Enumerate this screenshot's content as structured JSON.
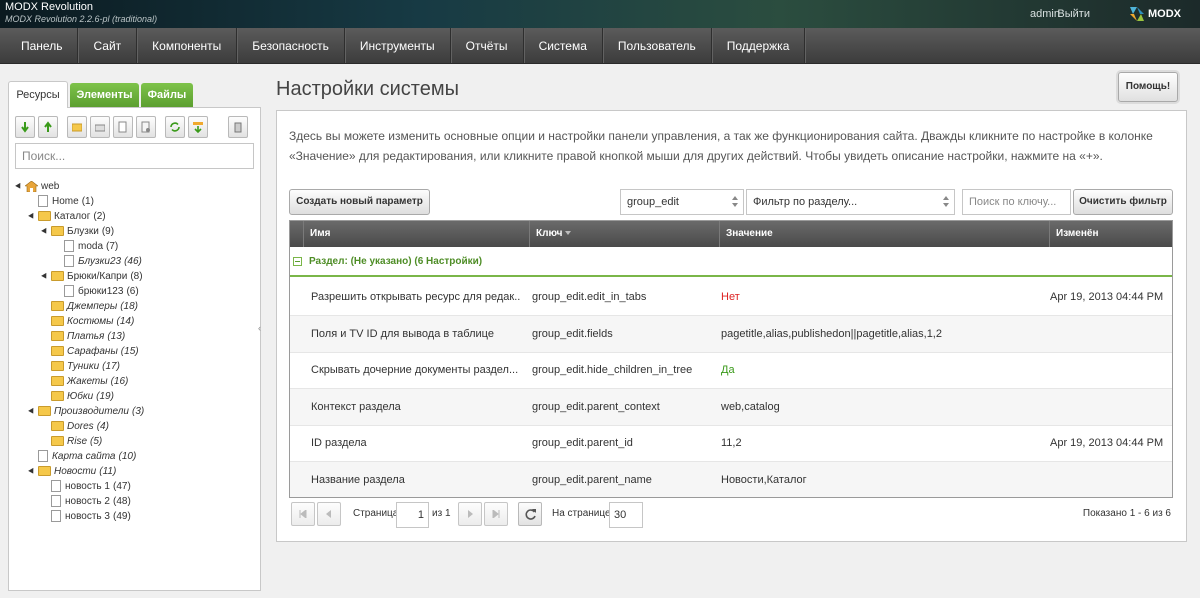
{
  "topbar": {
    "brand": "MODX Revolution",
    "version": "MODX Revolution 2.2.6-pl (traditional)",
    "user": "admin",
    "logout": "Выйти",
    "logo_text": "MODX"
  },
  "nav": [
    "Панель",
    "Сайт",
    "Компоненты",
    "Безопасность",
    "Инструменты",
    "Отчёты",
    "Система",
    "Пользователь",
    "Поддержка"
  ],
  "left": {
    "tabs": [
      "Ресурсы",
      "Элементы",
      "Файлы"
    ],
    "toolbar_icons": [
      "arrow-down-icon",
      "arrow-up-icon",
      "new-folder-icon",
      "new-weblink-icon",
      "new-document-icon",
      "new-static-icon",
      "refresh-icon",
      "sort-icon",
      "trash-icon"
    ],
    "search_placeholder": "Поиск...",
    "tree": [
      {
        "label": "web",
        "count": "",
        "type": "home",
        "level": 0,
        "italic": false
      },
      {
        "label": "Home",
        "count": "(1)",
        "type": "doc",
        "level": 1,
        "italic": false
      },
      {
        "label": "Каталог",
        "count": "(2)",
        "type": "folder",
        "level": 1,
        "italic": false,
        "open": true
      },
      {
        "label": "Блузки",
        "count": "(9)",
        "type": "folder",
        "level": 2,
        "italic": false,
        "open": true
      },
      {
        "label": "moda",
        "count": "(7)",
        "type": "doc",
        "level": 3,
        "italic": false
      },
      {
        "label": "Блузки23",
        "count": "(46)",
        "type": "doc",
        "level": 3,
        "italic": true
      },
      {
        "label": "Брюки/Капри",
        "count": "(8)",
        "type": "folder",
        "level": 2,
        "italic": false,
        "open": true
      },
      {
        "label": "брюки123",
        "count": "(6)",
        "type": "doc",
        "level": 3,
        "italic": false
      },
      {
        "label": "Джемперы",
        "count": "(18)",
        "type": "folder",
        "level": 2,
        "italic": true
      },
      {
        "label": "Костюмы",
        "count": "(14)",
        "type": "folder",
        "level": 2,
        "italic": true
      },
      {
        "label": "Платья",
        "count": "(13)",
        "type": "folder",
        "level": 2,
        "italic": true
      },
      {
        "label": "Сарафаны",
        "count": "(15)",
        "type": "folder",
        "level": 2,
        "italic": true
      },
      {
        "label": "Туники",
        "count": "(17)",
        "type": "folder",
        "level": 2,
        "italic": true
      },
      {
        "label": "Жакеты",
        "count": "(16)",
        "type": "folder",
        "level": 2,
        "italic": true
      },
      {
        "label": "Юбки",
        "count": "(19)",
        "type": "folder",
        "level": 2,
        "italic": true
      },
      {
        "label": "Производители",
        "count": "(3)",
        "type": "folder",
        "level": 1,
        "italic": true,
        "open": true
      },
      {
        "label": "Dores",
        "count": "(4)",
        "type": "folder",
        "level": 2,
        "italic": true
      },
      {
        "label": "Rise",
        "count": "(5)",
        "type": "folder",
        "level": 2,
        "italic": true
      },
      {
        "label": "Карта сайта",
        "count": "(10)",
        "type": "doc",
        "level": 1,
        "italic": true
      },
      {
        "label": "Новости",
        "count": "(11)",
        "type": "folder",
        "level": 1,
        "italic": true,
        "open": true
      },
      {
        "label": "новость 1",
        "count": "(47)",
        "type": "doc",
        "level": 2,
        "italic": false
      },
      {
        "label": "новость 2",
        "count": "(48)",
        "type": "doc",
        "level": 2,
        "italic": false
      },
      {
        "label": "новость 3",
        "count": "(49)",
        "type": "doc",
        "level": 2,
        "italic": false
      }
    ]
  },
  "main": {
    "title": "Настройки системы",
    "help_button": "Помощь!",
    "description": "Здесь вы можете изменить основные опции и настройки панели управления, а так же функционирования сайта. Дважды кликните по настройке в колонке «Значение» для редактирования, или кликните правой кнопкой мыши для других действий. Чтобы увидеть описание настройки, нажмите на «+».",
    "create_button": "Создать новый параметр",
    "namespace_value": "group_edit",
    "area_placeholder": "Фильтр по разделу...",
    "search_placeholder": "Поиск по ключу...",
    "clear_button": "Очистить фильтр",
    "columns": {
      "name": "Имя",
      "key": "Ключ",
      "value": "Значение",
      "modified": "Изменён"
    },
    "group_label": "Раздел: (Не указано) (6 Настройки)",
    "rows": [
      {
        "name": "Разрешить открывать ресурс для редак...",
        "key": "group_edit.edit_in_tabs",
        "value": "Нет",
        "value_style": "red",
        "modified": "Apr 19, 2013 04:44 PM"
      },
      {
        "name": "Поля и TV ID для вывода в таблице",
        "key": "group_edit.fields",
        "value": "pagetitle,alias,publishedon||pagetitle,alias,1,2",
        "value_style": "",
        "modified": ""
      },
      {
        "name": "Скрывать дочерние документы раздел...",
        "key": "group_edit.hide_children_in_tree",
        "value": "Да",
        "value_style": "green",
        "modified": ""
      },
      {
        "name": "Контекст раздела",
        "key": "group_edit.parent_context",
        "value": "web,catalog",
        "value_style": "",
        "modified": ""
      },
      {
        "name": "ID раздела",
        "key": "group_edit.parent_id",
        "value": "11,2",
        "value_style": "",
        "modified": "Apr 19, 2013 04:44 PM"
      },
      {
        "name": "Название раздела",
        "key": "group_edit.parent_name",
        "value": "Новости,Каталог",
        "value_style": "",
        "modified": ""
      }
    ],
    "pager": {
      "page_label": "Страница",
      "page_value": "1",
      "of_label": "из 1",
      "per_page_label": "На странице:",
      "per_page_value": "30",
      "summary": "Показано 1 - 6 из 6"
    }
  },
  "colors": {
    "accent_green": "#5a9d2e",
    "negative": "#dd2222",
    "positive": "#3a9a1a"
  }
}
